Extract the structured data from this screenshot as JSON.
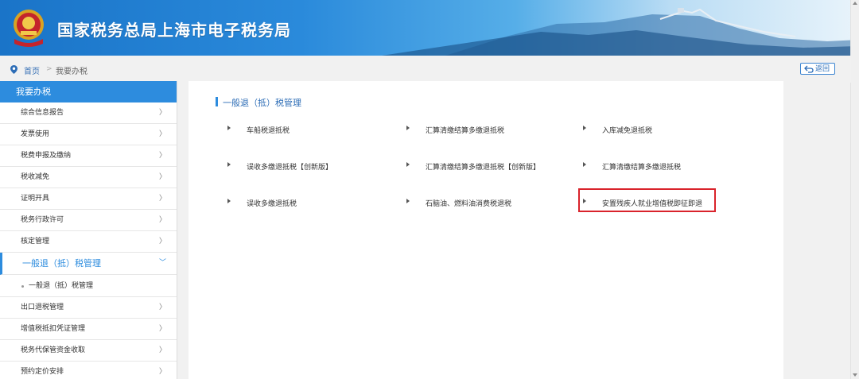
{
  "header": {
    "title": "国家税务总局上海市电子税务局"
  },
  "breadcrumb": {
    "home": "首页",
    "separator": ">",
    "current": "我要办税"
  },
  "back_button": {
    "label": "返回"
  },
  "sidebar": {
    "heading": "我要办税",
    "items": [
      {
        "label": "综合信息报告"
      },
      {
        "label": "发票使用"
      },
      {
        "label": "税费申报及缴纳"
      },
      {
        "label": "税收减免"
      },
      {
        "label": "证明开具"
      },
      {
        "label": "税务行政许可"
      },
      {
        "label": "核定管理"
      }
    ],
    "active_item": {
      "label": "一般退（抵）税管理"
    },
    "sub_item": {
      "label": "一般退（抵）税管理"
    },
    "items_after": [
      {
        "label": "出口退税管理"
      },
      {
        "label": "增值税抵扣凭证管理"
      },
      {
        "label": "税务代保管资金收取"
      },
      {
        "label": "预约定价安排"
      }
    ]
  },
  "main": {
    "section_title": "一般退（抵）税管理",
    "links": [
      "车船税退抵税",
      "汇算清缴结算多缴退抵税",
      "入库减免退抵税",
      "误收多缴退抵税【创新版】",
      "汇算清缴结算多缴退抵税【创新版】",
      "汇算清缴结算多缴退抵税",
      "误收多缴退抵税",
      "石脑油、燃料油消费税退税",
      "安置残疾人就业增值税即征即退"
    ]
  },
  "colors": {
    "header_blue": "#1a74c8",
    "accent": "#2d8cde",
    "highlight_red": "#d9232b"
  }
}
